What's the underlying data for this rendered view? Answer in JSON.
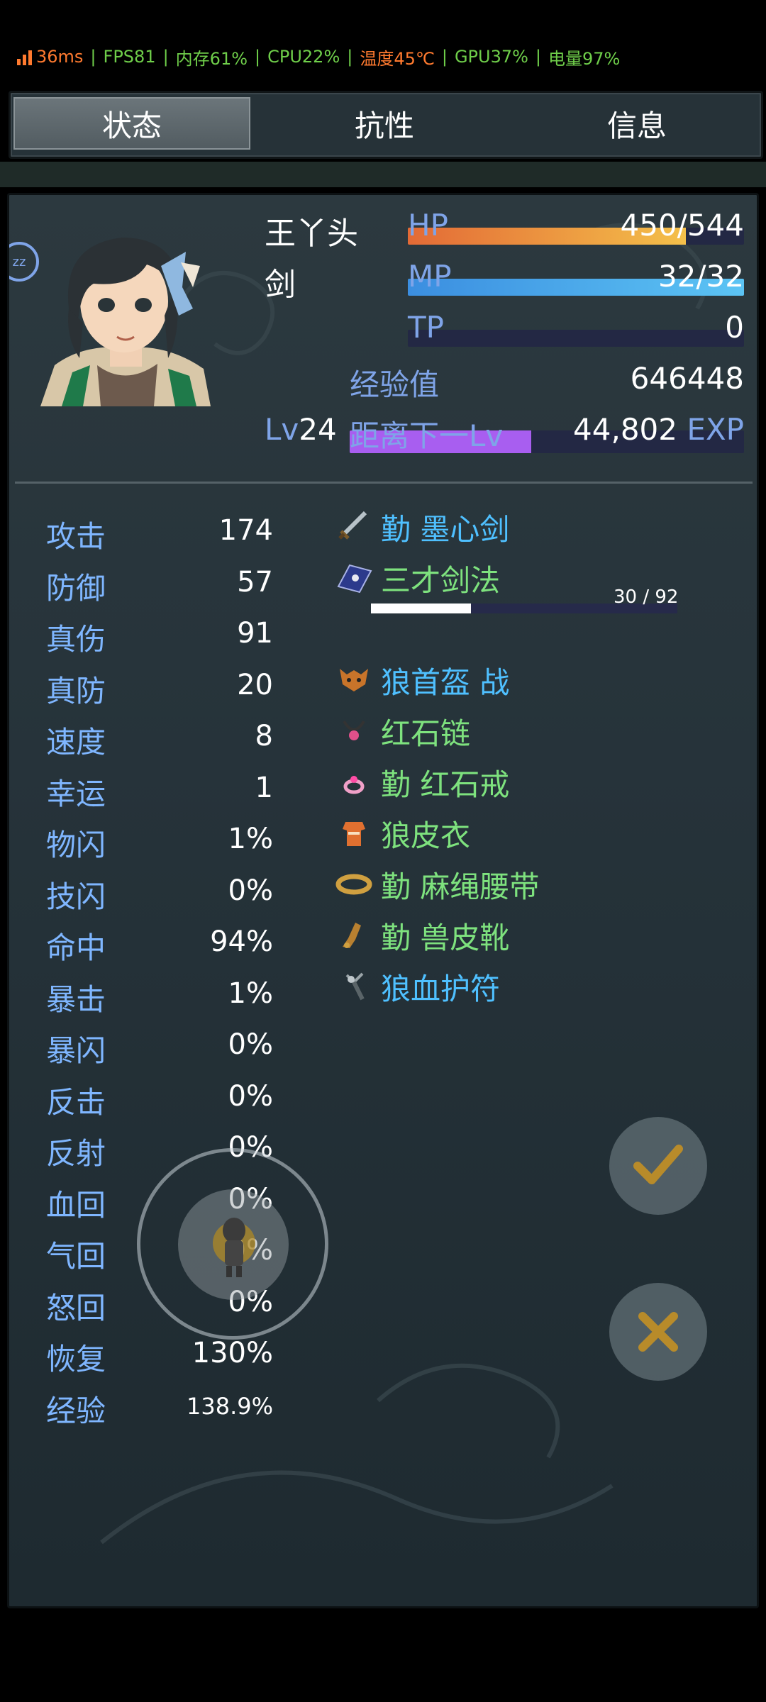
{
  "perf": {
    "ping": "36ms",
    "fps": "FPS81",
    "memory": "内存61%",
    "cpu": "CPU22%",
    "temp": "温度45℃",
    "gpu": "GPU37%",
    "battery": "电量97%"
  },
  "tabs": [
    {
      "label": "状态",
      "active": true
    },
    {
      "label": "抗性",
      "active": false
    },
    {
      "label": "信息",
      "active": false
    }
  ],
  "character": {
    "name": "王丫头",
    "class": "剑",
    "level_label": "Lv",
    "level": "24",
    "hp_label": "HP",
    "hp": "450/544",
    "hp_fraction": 0.827,
    "mp_label": "MP",
    "mp": "32/32",
    "mp_fraction": 1.0,
    "tp_label": "TP",
    "tp": "0",
    "tp_fraction": 0,
    "exp_label": "经验值",
    "exp": "646448",
    "next_label": "距离下一Lv",
    "next_value": "44,802",
    "next_unit": "EXP",
    "next_fraction": 0.46
  },
  "stats": [
    {
      "label": "攻击",
      "value": "174"
    },
    {
      "label": "防御",
      "value": "57"
    },
    {
      "label": "真伤",
      "value": "91"
    },
    {
      "label": "真防",
      "value": "20"
    },
    {
      "label": "速度",
      "value": "8"
    },
    {
      "label": "幸运",
      "value": "1"
    },
    {
      "label": "物闪",
      "value": "1%"
    },
    {
      "label": "技闪",
      "value": "0%"
    },
    {
      "label": "命中",
      "value": "94%"
    },
    {
      "label": "暴击",
      "value": "1%"
    },
    {
      "label": "暴闪",
      "value": "0%"
    },
    {
      "label": "反击",
      "value": "0%"
    },
    {
      "label": "反射",
      "value": "0%"
    },
    {
      "label": "血回",
      "value": "0%"
    },
    {
      "label": "气回",
      "value": "0%"
    },
    {
      "label": "怒回",
      "value": "0%"
    },
    {
      "label": "恢复",
      "value": "130%"
    },
    {
      "label": "经验",
      "value": "138.9%"
    }
  ],
  "equipment": [
    {
      "label": "勤 墨心剑",
      "icon": "sword-icon",
      "color": "#4fc0ff"
    },
    {
      "label": "三才剑法",
      "icon": "skill-book-icon",
      "color": "#7ee27e"
    },
    {
      "label": "狼首盔 战",
      "icon": "wolf-helmet-icon",
      "color": "#4fc0ff"
    },
    {
      "label": "红石链",
      "icon": "necklace-icon",
      "color": "#7ee27e"
    },
    {
      "label": "勤 红石戒",
      "icon": "ring-icon",
      "color": "#7ee27e"
    },
    {
      "label": "狼皮衣",
      "icon": "armor-icon",
      "color": "#7ee27e"
    },
    {
      "label": "勤 麻绳腰带",
      "icon": "belt-icon",
      "color": "#7ee27e"
    },
    {
      "label": "勤 兽皮靴",
      "icon": "boots-icon",
      "color": "#7ee27e"
    },
    {
      "label": "狼血护符",
      "icon": "amulet-icon",
      "color": "#4fc0ff"
    }
  ],
  "skill_progress": {
    "text": "30 / 92",
    "fraction": 0.326
  },
  "buttons": {
    "confirm_icon": "check-icon",
    "cancel_icon": "close-icon",
    "joystick_icon": "character-sprite-icon",
    "sleep_badge": "zz-icon"
  },
  "colors": {
    "hp": "#f0b040",
    "mp": "#48b0f0",
    "exp": "#b060f0",
    "accent": "#7fa4e8"
  }
}
